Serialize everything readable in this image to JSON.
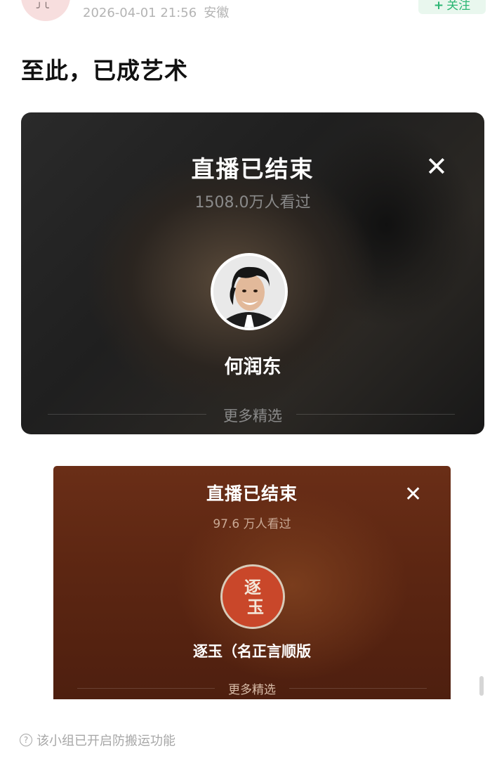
{
  "post": {
    "timestamp": "2026-04-01 21:56",
    "location": "安徽",
    "follow_label": "关注",
    "title": "至此，已成艺术"
  },
  "live_cards": [
    {
      "title": "直播已结束",
      "viewers": "1508.0万人看过",
      "name": "何润东",
      "more": "更多精选"
    },
    {
      "title": "直播已结束",
      "viewers": "97.6 万人看过",
      "name": "逐玉（名正言顺版",
      "logo_text": "逐玉",
      "more": "更多精选"
    }
  ],
  "notice": {
    "text": "该小组已开启防搬运功能"
  },
  "colors": {
    "follow_green": "#2bb673",
    "card2_brown": "#5c2612"
  },
  "icons": {
    "close": "close-icon",
    "help": "question-circle-icon"
  }
}
